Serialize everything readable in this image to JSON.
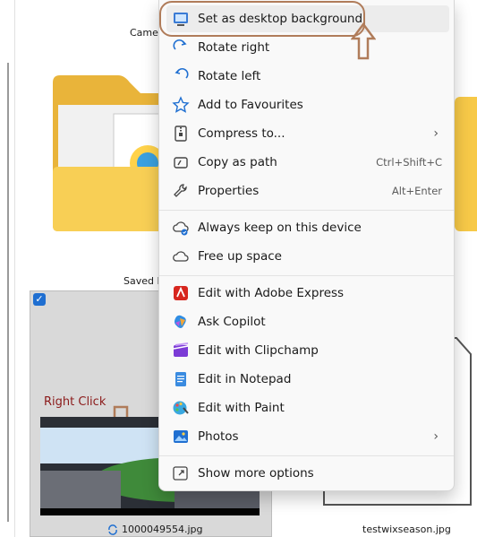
{
  "tiles": {
    "camera_label": "Camer",
    "saved_label": "Saved P",
    "selected_file": "1000049554.jpg",
    "doc_file": "testwixseason.jpg"
  },
  "annotation": {
    "right_click": "Right Click"
  },
  "menu": {
    "items": [
      {
        "label": "Set as desktop background",
        "icon": "desktop-background-icon"
      },
      {
        "label": "Rotate right",
        "icon": "rotate-right-icon"
      },
      {
        "label": "Rotate left",
        "icon": "rotate-left-icon"
      },
      {
        "label": "Add to Favourites",
        "icon": "star-icon"
      },
      {
        "label": "Compress to...",
        "icon": "zip-icon"
      },
      {
        "label": "Copy as path",
        "icon": "copy-path-icon",
        "shortcut": "Ctrl+Shift+C"
      },
      {
        "label": "Properties",
        "icon": "wrench-icon",
        "shortcut": "Alt+Enter"
      },
      {
        "label": "Always keep on this device",
        "icon": "cloud-keep-icon"
      },
      {
        "label": "Free up space",
        "icon": "cloud-icon"
      },
      {
        "label": "Edit with Adobe Express",
        "icon": "adobe-icon"
      },
      {
        "label": "Ask Copilot",
        "icon": "copilot-icon"
      },
      {
        "label": "Edit with Clipchamp",
        "icon": "clipchamp-icon"
      },
      {
        "label": "Edit in Notepad",
        "icon": "notepad-icon"
      },
      {
        "label": "Edit with Paint",
        "icon": "paint-icon"
      },
      {
        "label": "Photos",
        "icon": "photos-icon"
      },
      {
        "label": "Show more options",
        "icon": "more-options-icon"
      }
    ]
  },
  "colors": {
    "annotation": "#b07c5a",
    "folder": "#f7c948"
  }
}
